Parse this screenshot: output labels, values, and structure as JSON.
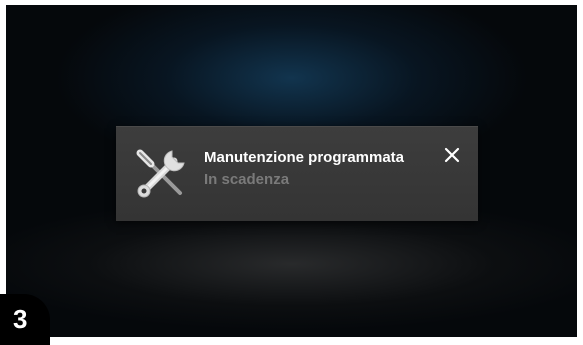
{
  "notification": {
    "title": "Manutenzione programmata",
    "subtitle": "In scadenza",
    "icon": "wrench-screwdriver-icon",
    "close_icon": "close-icon"
  },
  "step_badge": {
    "number": "3"
  }
}
